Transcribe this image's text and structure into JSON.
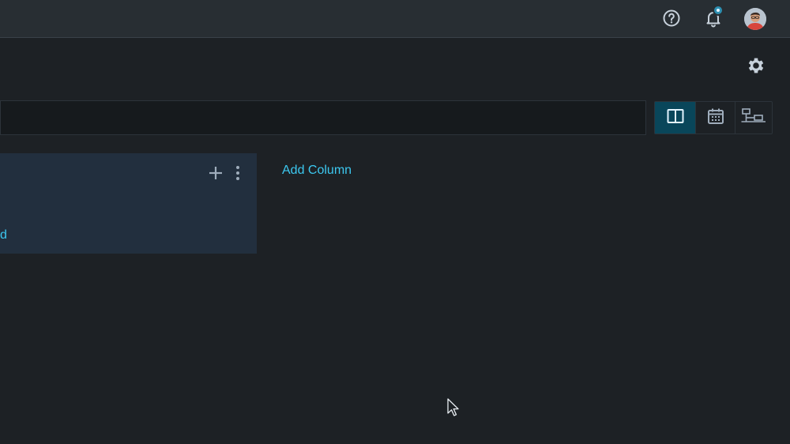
{
  "topbar": {
    "help_icon": "help-circle-icon",
    "notifications_icon": "bell-icon",
    "notification_indicator": true,
    "avatar": "user-avatar"
  },
  "toolbar": {
    "settings_icon": "gear-icon"
  },
  "view_switcher": {
    "options": [
      {
        "icon": "board-view-icon",
        "active": true
      },
      {
        "icon": "calendar-view-icon",
        "active": false
      },
      {
        "icon": "tree-view-icon",
        "active": false
      }
    ]
  },
  "board": {
    "column": {
      "add_icon": "plus-icon",
      "menu_icon": "kebab-menu-icon",
      "link_label": "d"
    },
    "add_column_label": "Add Column"
  },
  "colors": {
    "background": "#1d2125",
    "topbar": "#282e33",
    "card": "#222f3e",
    "accent": "#3cc8f0",
    "active_view": "#09465a"
  }
}
